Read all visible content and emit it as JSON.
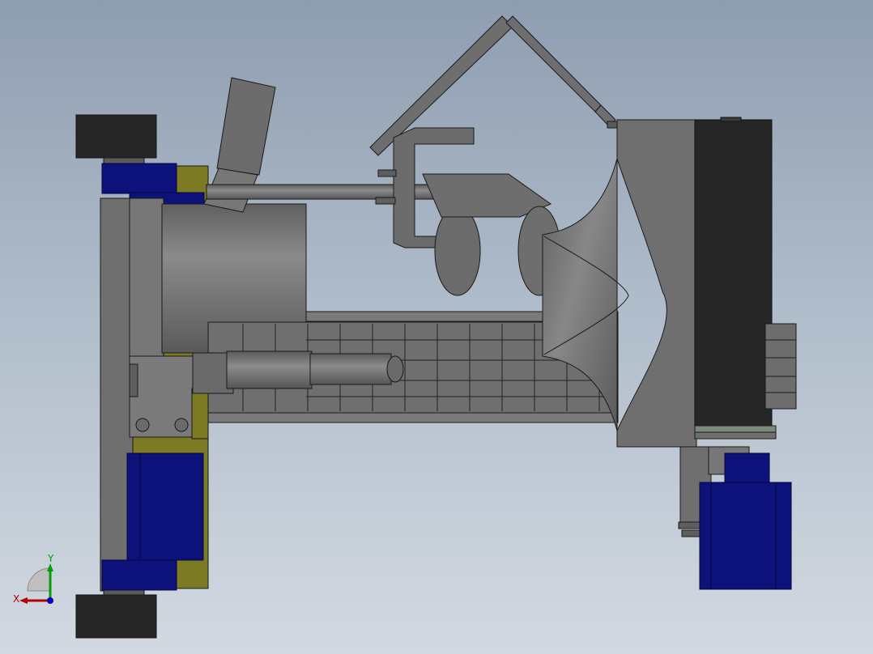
{
  "viewport": {
    "background_top": "#8e9db0",
    "background_bottom": "#d3d9e1"
  },
  "colors": {
    "body_gray": "#6b6b6b",
    "light_gray": "#7c7c7c",
    "dark_block": "#262626",
    "motor_blue": "#0c127a",
    "plate_olive": "#7c7a22",
    "outline": "#1a1a1a"
  },
  "triad": {
    "x_label": "X",
    "y_label": "Y",
    "x_color": "#b00000",
    "y_color": "#00a000",
    "z_color": "#0000c0"
  }
}
